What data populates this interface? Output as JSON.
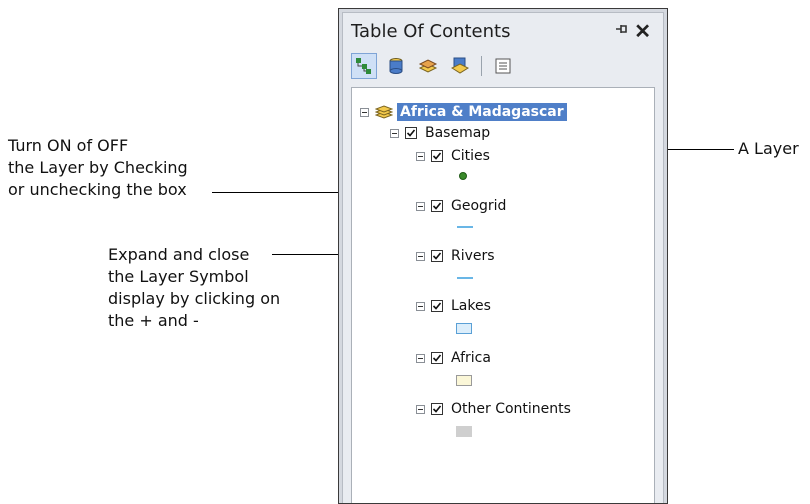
{
  "annotations": {
    "toggle": [
      "Turn ON of OFF",
      "the Layer by Checking",
      "or unchecking the box"
    ],
    "expand": [
      "Expand and close",
      "the Layer Symbol",
      "display by clicking on",
      "the + and -"
    ],
    "layer": "A Layer"
  },
  "window": {
    "title": "Table Of Contents",
    "pin_icon": "pin-icon",
    "close_icon": "close-icon"
  },
  "toolbar": {
    "buttons": [
      "list-by-drawing-order-icon",
      "list-by-source-icon",
      "list-by-visibility-icon",
      "list-by-selection-icon",
      "options-icon"
    ]
  },
  "tree": {
    "root": "Africa & Madagascar",
    "group": "Basemap",
    "layers": [
      {
        "label": "Cities",
        "symbol": "point",
        "color": "#3a8a2a",
        "checked": true
      },
      {
        "label": "Geogrid",
        "symbol": "line",
        "color": "#69b6e6",
        "checked": true
      },
      {
        "label": "Rivers",
        "symbol": "line",
        "color": "#69b6e6",
        "checked": true
      },
      {
        "label": "Lakes",
        "symbol": "polygon",
        "color": "#dceefb",
        "checked": true
      },
      {
        "label": "Africa",
        "symbol": "polygon",
        "color": "#fbf7d8",
        "checked": true
      },
      {
        "label": "Other Continents",
        "symbol": "polygon",
        "color": "#cfcfcf",
        "checked": true
      }
    ]
  }
}
